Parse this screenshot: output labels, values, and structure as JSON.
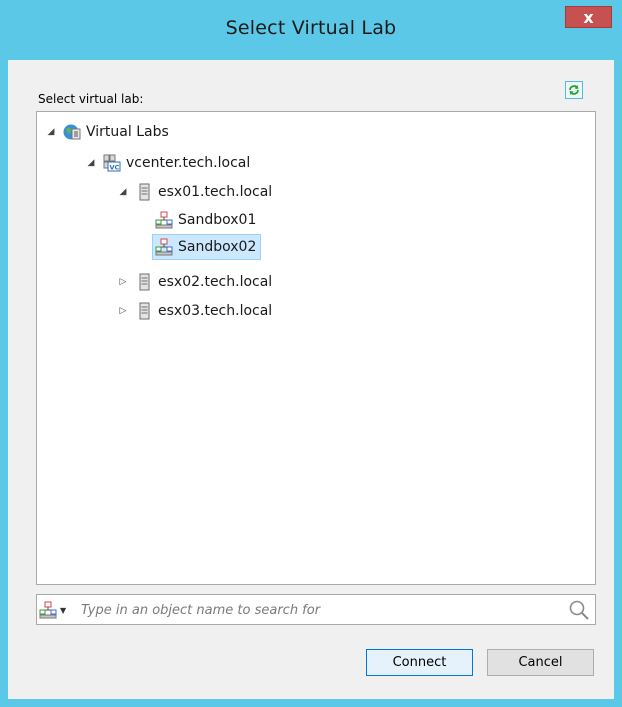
{
  "window": {
    "title": "Select Virtual Lab",
    "close_label": "x"
  },
  "select_label": "Select virtual lab:",
  "tree": {
    "root": {
      "label": "Virtual Labs",
      "icon": "virtual-labs-globe-icon",
      "expanded": true
    },
    "vcenter": {
      "label": "vcenter.tech.local",
      "icon": "vcenter-icon",
      "expanded": true
    },
    "hosts": [
      {
        "label": "esx01.tech.local",
        "icon": "server-icon",
        "expanded": true
      },
      {
        "label": "esx02.tech.local",
        "icon": "server-icon",
        "expanded": false
      },
      {
        "label": "esx03.tech.local",
        "icon": "server-icon",
        "expanded": false
      }
    ],
    "labs": [
      {
        "label": "Sandbox01",
        "icon": "virtual-lab-icon",
        "selected": false
      },
      {
        "label": "Sandbox02",
        "icon": "virtual-lab-icon",
        "selected": true
      }
    ]
  },
  "search": {
    "placeholder": "Type in an object name to search for",
    "value": ""
  },
  "buttons": {
    "connect": "Connect",
    "cancel": "Cancel"
  },
  "colors": {
    "titlebar": "#5bc8e8",
    "close": "#c75050",
    "selection": "#cce8ff",
    "refresh_green": "#2aa52a"
  }
}
